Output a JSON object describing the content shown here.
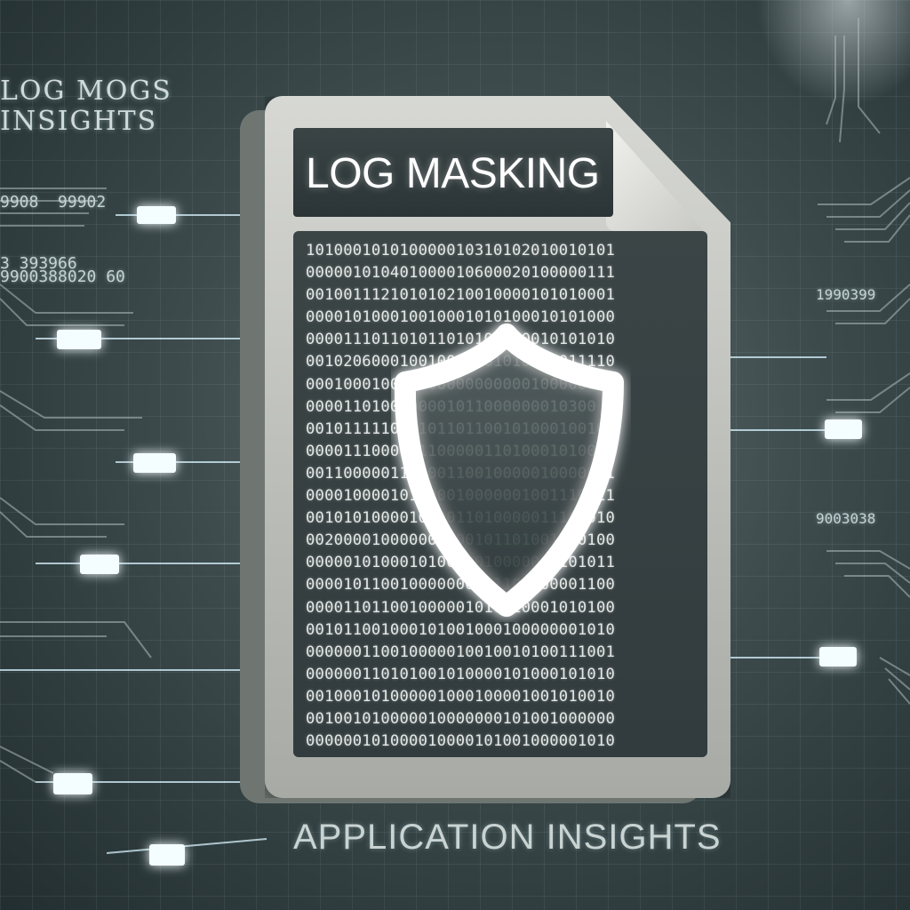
{
  "corner_text": {
    "line1": "LOG MOGS",
    "line2": "INSIGHTS"
  },
  "left_code": [
    "9908  99902",
    "9900388020 60",
    "3 393966"
  ],
  "right_code": [
    "1990399",
    "9003038"
  ],
  "document": {
    "title": "LOG MASKING",
    "binary_rows": [
      "101000101010000010310102010010101",
      "000001010401000010600020100000111",
      "001001112101010210010000101010001",
      "000010100010010001010100010101000",
      "000011101101011010101000010101010",
      "001020600010010010001010010011110",
      "000100010000000000000000100000010",
      "0000110100000001011000000010300",
      "001011111010101101100101000100100",
      "000011100000110000011010001010010",
      "001100000110100110010000010000001",
      "000010000101000010000001001110011",
      "001010100001000011010000011100010",
      "002000010000000000101101001000100",
      "000001010001010000010000000101011",
      "000010110010000000001101100001100",
      "000011011001000001010010001010100",
      "001011001000101001000100000001010",
      "000000110010000010010010100111001",
      "000000110101001010000101000101010",
      "001000101000001000100001001010010",
      "001001010000010000000101001000000",
      "000000101000010000101001000001010"
    ],
    "icon": "shield-icon"
  },
  "footer": "APPLICATION INSIGHTS",
  "colors": {
    "background": "#3d4b4d",
    "glow": "#e8fbff",
    "document": "#c9cac5",
    "panel": "#343e40"
  }
}
